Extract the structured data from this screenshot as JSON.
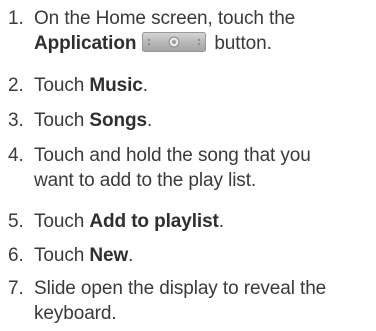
{
  "steps": [
    {
      "number": "1.",
      "line1_before": "On the Home screen, touch the",
      "line2_bold": "Application",
      "line2_after": "button.",
      "icon": "application-button-icon"
    },
    {
      "number": "2.",
      "before": "Touch ",
      "bold": "Music",
      "after": "."
    },
    {
      "number": "3.",
      "before": "Touch ",
      "bold": "Songs",
      "after": "."
    },
    {
      "number": "4.",
      "line1": "Touch and hold the song that you",
      "line2": "want to add to the play list."
    },
    {
      "number": "5.",
      "before": "Touch ",
      "bold": "Add to playlist",
      "after": "."
    },
    {
      "number": "6.",
      "before": "Touch ",
      "bold": "New",
      "after": "."
    },
    {
      "number": "7.",
      "line1": "Slide open the display to reveal the",
      "line2": "keyboard."
    }
  ]
}
